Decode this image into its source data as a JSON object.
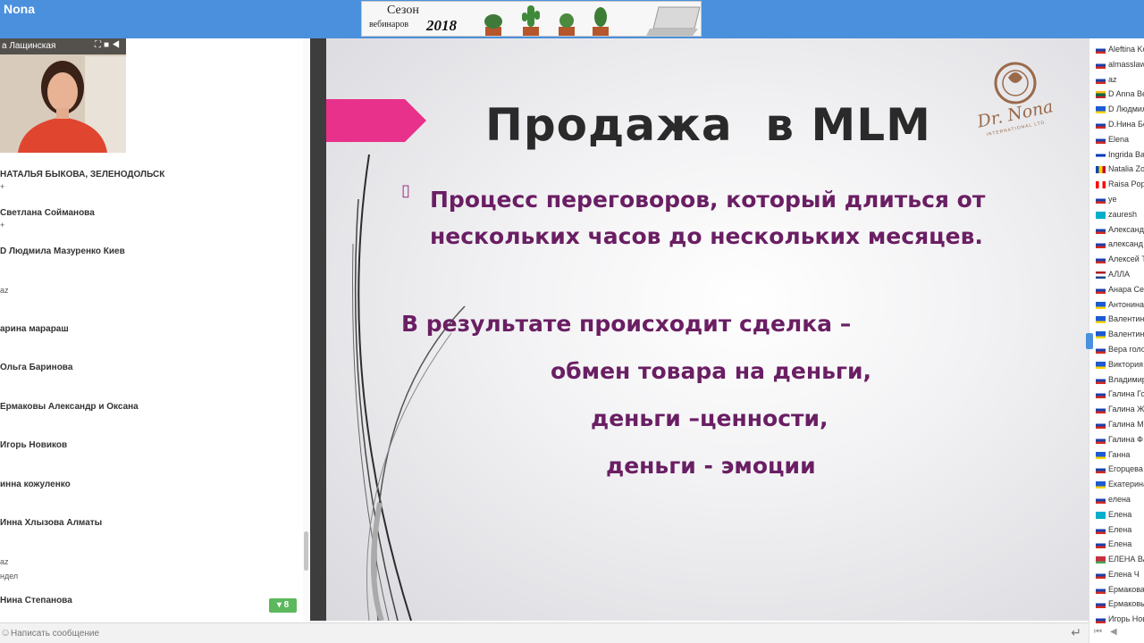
{
  "app": {
    "title": "Nona"
  },
  "banner": {
    "line1": "Сезон",
    "line2": "вебинаров",
    "year": "2018"
  },
  "video": {
    "presenter_name": "а Лащинская"
  },
  "chat": {
    "messages": [
      {
        "name": "НАТАЛЬЯ БЫКОВА, ЗЕЛЕНОДОЛЬСК",
        "text": "+"
      },
      {
        "name": "Светлана Сойманова",
        "text": "+"
      },
      {
        "name": "D Людмила Мазуренко Киев",
        "text": ""
      },
      {
        "name": "",
        "text": "az"
      },
      {
        "name": "арина марараш",
        "text": ""
      },
      {
        "name": "Ольга Баринова",
        "text": ""
      },
      {
        "name": "Ермаковы Александр и Оксана",
        "text": ""
      },
      {
        "name": "Игорь Новиков",
        "text": ""
      },
      {
        "name": "инна кожуленко",
        "text": ""
      },
      {
        "name": "Инна Хлызова Алматы",
        "text": ""
      },
      {
        "name": "",
        "text": "az"
      },
      {
        "name": "",
        "text": "ндел"
      },
      {
        "name": "Нина Степанова",
        "text": ""
      }
    ],
    "new_count": "8",
    "input_placeholder": "Написать сообщение"
  },
  "slide": {
    "title": "Продажа  в MLM",
    "bullet_line1": "Процесс переговоров, который длиться от",
    "bullet_line2": "нескольких часов до нескольких месяцев.",
    "line1": "В результате происходит сделка –",
    "line2": "обмен товара на деньги,",
    "line3": "деньги –ценности,",
    "line4": "деньги - эмоции",
    "logo_text": "Dr. Nona",
    "logo_sub": "INTERNATIONAL LTD."
  },
  "participants": [
    {
      "name": "Aleftina Ko",
      "flag": "ru"
    },
    {
      "name": "almasslaw",
      "flag": "ru"
    },
    {
      "name": "az",
      "flag": "ru"
    },
    {
      "name": "D Anna Be",
      "flag": "lt"
    },
    {
      "name": "D Людмил",
      "flag": "ua"
    },
    {
      "name": "D.Нина Бе",
      "flag": "ru"
    },
    {
      "name": "Elena",
      "flag": "ru"
    },
    {
      "name": "Ingrida Ba",
      "flag": "il"
    },
    {
      "name": "Natalia Zo",
      "flag": "md"
    },
    {
      "name": "Raisa Popo",
      "flag": "ca"
    },
    {
      "name": "ye",
      "flag": "ru"
    },
    {
      "name": "zauresh",
      "flag": "kz"
    },
    {
      "name": "Александ",
      "flag": "ru"
    },
    {
      "name": "александ",
      "flag": "ru"
    },
    {
      "name": "Алексей Т",
      "flag": "ru"
    },
    {
      "name": "АЛЛА",
      "flag": "nl"
    },
    {
      "name": "Анара Сер",
      "flag": "ru"
    },
    {
      "name": "Антонина",
      "flag": "ua"
    },
    {
      "name": "Валентин",
      "flag": "ua"
    },
    {
      "name": "Валентин",
      "flag": "ua"
    },
    {
      "name": "Вера голо",
      "flag": "ru"
    },
    {
      "name": "Виктория",
      "flag": "ua"
    },
    {
      "name": "Владимир",
      "flag": "ru"
    },
    {
      "name": "Галина Го",
      "flag": "ru"
    },
    {
      "name": "Галина Ж",
      "flag": "ru"
    },
    {
      "name": "Галина М",
      "flag": "ru"
    },
    {
      "name": "Галина Ф",
      "flag": "ru"
    },
    {
      "name": "Ганна",
      "flag": "ua"
    },
    {
      "name": "Егорцева",
      "flag": "ru"
    },
    {
      "name": "Екатерина",
      "flag": "ua"
    },
    {
      "name": "елена",
      "flag": "ru"
    },
    {
      "name": "Елена",
      "flag": "kz"
    },
    {
      "name": "Елена",
      "flag": "ru"
    },
    {
      "name": "Елена",
      "flag": "ru"
    },
    {
      "name": "ЕЛЕНА ВА",
      "flag": "by"
    },
    {
      "name": "Елена Ч",
      "flag": "ru"
    },
    {
      "name": "Ермакова",
      "flag": "ru"
    },
    {
      "name": "Ермаковы",
      "flag": "ru"
    },
    {
      "name": "Игорь Нов",
      "flag": "ru"
    }
  ],
  "colors": {
    "topbar": "#4a90dc",
    "slide_text": "#6a1e63",
    "pink_accent": "#e8318a",
    "badge": "#5cb85c"
  }
}
